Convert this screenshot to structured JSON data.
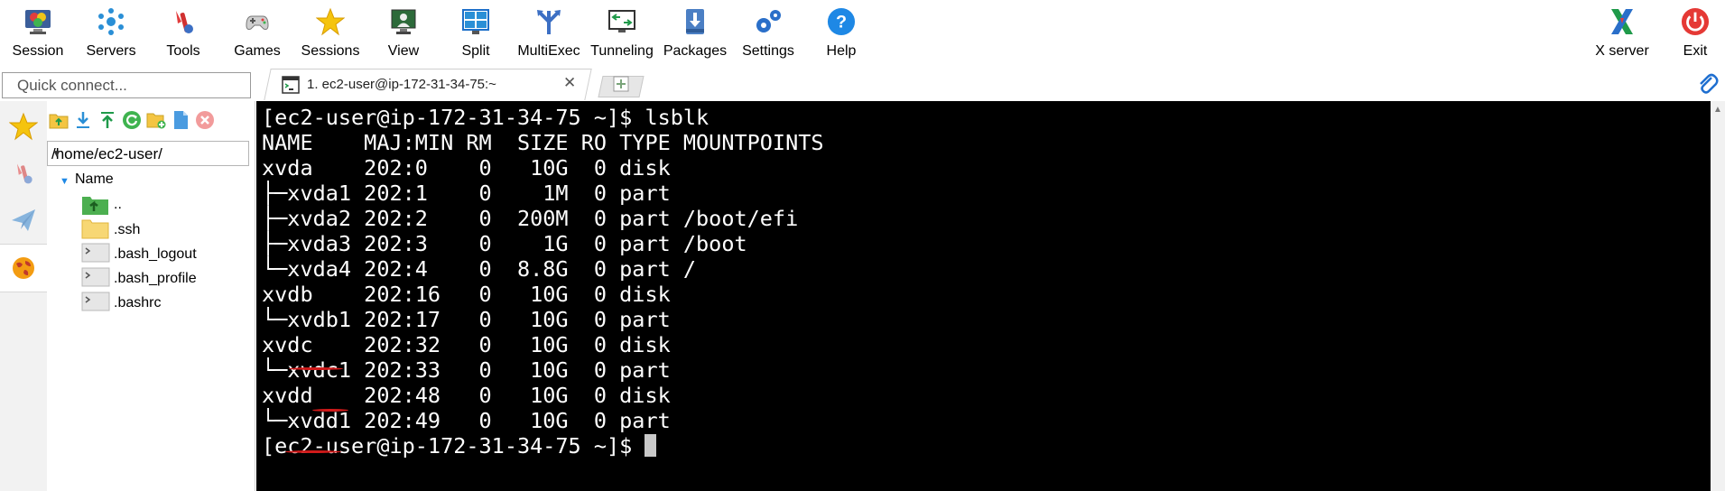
{
  "toolbar": {
    "items": [
      {
        "label": "Session",
        "icon": "session-icon"
      },
      {
        "label": "Servers",
        "icon": "servers-icon"
      },
      {
        "label": "Tools",
        "icon": "tools-icon"
      },
      {
        "label": "Games",
        "icon": "gamepad-icon"
      },
      {
        "label": "Sessions",
        "icon": "star-icon"
      },
      {
        "label": "View",
        "icon": "view-icon"
      },
      {
        "label": "Split",
        "icon": "split-icon"
      },
      {
        "label": "MultiExec",
        "icon": "multiexec-icon"
      },
      {
        "label": "Tunneling",
        "icon": "tunneling-icon"
      },
      {
        "label": "Packages",
        "icon": "packages-icon"
      },
      {
        "label": "Settings",
        "icon": "gears-icon"
      },
      {
        "label": "Help",
        "icon": "help-icon"
      }
    ],
    "right_items": [
      {
        "label": "X server",
        "icon": "x-server-icon"
      },
      {
        "label": "Exit",
        "icon": "power-icon"
      }
    ]
  },
  "quick_connect": {
    "placeholder": "Quick connect..."
  },
  "tab": {
    "label": "1. ec2-user@ip-172-31-34-75:~"
  },
  "sidebar_tabs": [
    "star-icon",
    "tools-icon",
    "paper-plane-icon",
    "globe-icon"
  ],
  "file_panel": {
    "path": "/home/ec2-user/",
    "column_header": "Name",
    "files": [
      {
        "name": "..",
        "icon": "parent-folder-icon"
      },
      {
        "name": ".ssh",
        "icon": "folder-icon"
      },
      {
        "name": ".bash_logout",
        "icon": "terminal-file-icon"
      },
      {
        "name": ".bash_profile",
        "icon": "terminal-file-icon"
      },
      {
        "name": ".bashrc",
        "icon": "terminal-file-icon"
      }
    ]
  },
  "terminal": {
    "lines": [
      "[ec2-user@ip-172-31-34-75 ~]$ lsblk",
      "NAME    MAJ:MIN RM  SIZE RO TYPE MOUNTPOINTS",
      "xvda    202:0    0   10G  0 disk",
      "├─xvda1 202:1    0    1M  0 part",
      "├─xvda2 202:2    0  200M  0 part /boot/efi",
      "├─xvda3 202:3    0    1G  0 part /boot",
      "└─xvda4 202:4    0  8.8G  0 part /",
      "xvdb    202:16   0   10G  0 disk",
      "└─xvdb1 202:17   0   10G  0 part",
      "xvdc    202:32   0   10G  0 disk",
      "└─xvdc1 202:33   0   10G  0 part",
      "xvdd    202:48   0   10G  0 disk",
      "└─xvdd1 202:49   0   10G  0 part"
    ],
    "prompt": "[ec2-user@ip-172-31-34-75 ~]$ "
  },
  "colors": {
    "terminal_bg": "#000000",
    "terminal_fg": "#ffffff",
    "annotation": "#d11a1a"
  }
}
